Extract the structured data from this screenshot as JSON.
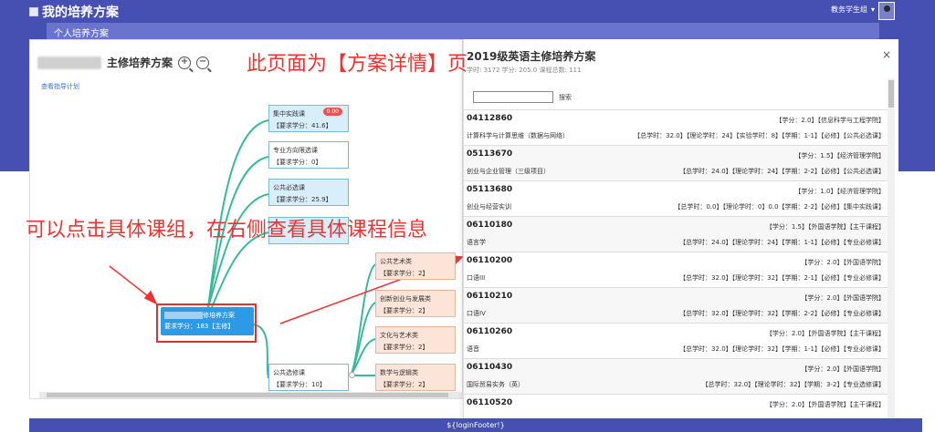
{
  "app": {
    "title": "我的培养方案",
    "user": "教务学生组"
  },
  "subbar": {
    "label": "个人培养方案"
  },
  "plan": {
    "title_suffix": "主修培养方案",
    "view_link": "查看指导计划",
    "zoom_in": "+",
    "zoom_out": "−",
    "root": {
      "title_suffix": "修培养方案",
      "requirement": "要求学分：183【主修】"
    },
    "nodes": [
      {
        "name": "集中实践课",
        "req": "【要求学分：41.6】",
        "badge": "0.00"
      },
      {
        "name": "专业方向限选课",
        "req": "【要求学分：0】"
      },
      {
        "name": "公共必选课",
        "req": "【要求学分：25.9】"
      },
      {
        "name": "公共艺术类",
        "req": "【要求学分：2】"
      },
      {
        "name": "创新创业与发展类",
        "req": "【要求学分：2】"
      },
      {
        "name": "文化与艺术类",
        "req": "【要求学分：2】"
      },
      {
        "name": "公共选修课",
        "req": "【要求学分：10】"
      },
      {
        "name": "数学与逻辑类",
        "req": "【要求学分：2】"
      }
    ]
  },
  "annotations": {
    "page_note": "此页面为【方案详情】页",
    "click_note": "可以点击具体课组，在右侧查看具体课程信息"
  },
  "detail": {
    "title": "2019级英语主修培养方案",
    "meta": "学时: 3172 学分: 205.0 课程总数: 111",
    "close": "×",
    "search_placeholder": "",
    "search_label": "搜索",
    "scroll_arrow": "▼",
    "courses": [
      {
        "code": "04112860",
        "tag1": "【学分：2.0】【信息科学与工程学院】",
        "name": "计算科学与计算思维（数据与网络）",
        "tag2": "【总学时：32.0】【理论学时：24】【实验学时：8】【学期：1-1】【必修】【公共必选课】"
      },
      {
        "code": "05113670",
        "tag1": "【学分：1.5】【经济管理学院】",
        "name": "创业与企业管理（三级项目）",
        "tag2": "【总学时：24.0】【理论学时：24】【学期：2-2】【必修】【公共必选课】"
      },
      {
        "code": "05113680",
        "tag1": "【学分：1.0】【经济管理学院】",
        "name": "创业与经营实训",
        "tag2": "【总学时：0.0】【理论学时：0】0.0【学期：2-2】【必修】【集中实践课】"
      },
      {
        "code": "06110180",
        "tag1": "【学分：1.5】【外国语学院】【主干课程】",
        "name": "语言学",
        "tag2": "【总学时：24.0】【理论学时：24】【学期：1-1】【必修】【专业必修课】"
      },
      {
        "code": "06110200",
        "tag1": "【学分：2.0】【外国语学院】",
        "name": "口语III",
        "tag2": "【总学时：32.0】【理论学时：32】【学期：2-1】【必修】【专业必修课】"
      },
      {
        "code": "06110210",
        "tag1": "【学分：2.0】【外国语学院】",
        "name": "口语IV",
        "tag2": "【总学时：32.0】【理论学时：32】【学期：2-2】【必修】【专业必修课】"
      },
      {
        "code": "06110260",
        "tag1": "【学分：2.0】【外国语学院】【主干课程】",
        "name": "语音",
        "tag2": "【总学时：32.0】【理论学时：32】【学期：1-1】【必修】【专业必修课】"
      },
      {
        "code": "06110430",
        "tag1": "【学分：2.0】【外国语学院】",
        "name": "国际贸易实务（英）",
        "tag2": "【总学时：32.0】【理论学时：32】【学期：3-2】【专业选修课】"
      },
      {
        "code": "06110520",
        "tag1": "【学分：2.0】【外国语学院】【主干课程】",
        "name": "",
        "tag2": ""
      }
    ]
  },
  "footer": {
    "text": "${loginFooter!}"
  },
  "colors": {
    "header": "#4650b3",
    "subbar": "#6a73cd",
    "root": "#2e9ae6",
    "annotation": "#ee3333",
    "mind_line": "#3cb89a"
  }
}
